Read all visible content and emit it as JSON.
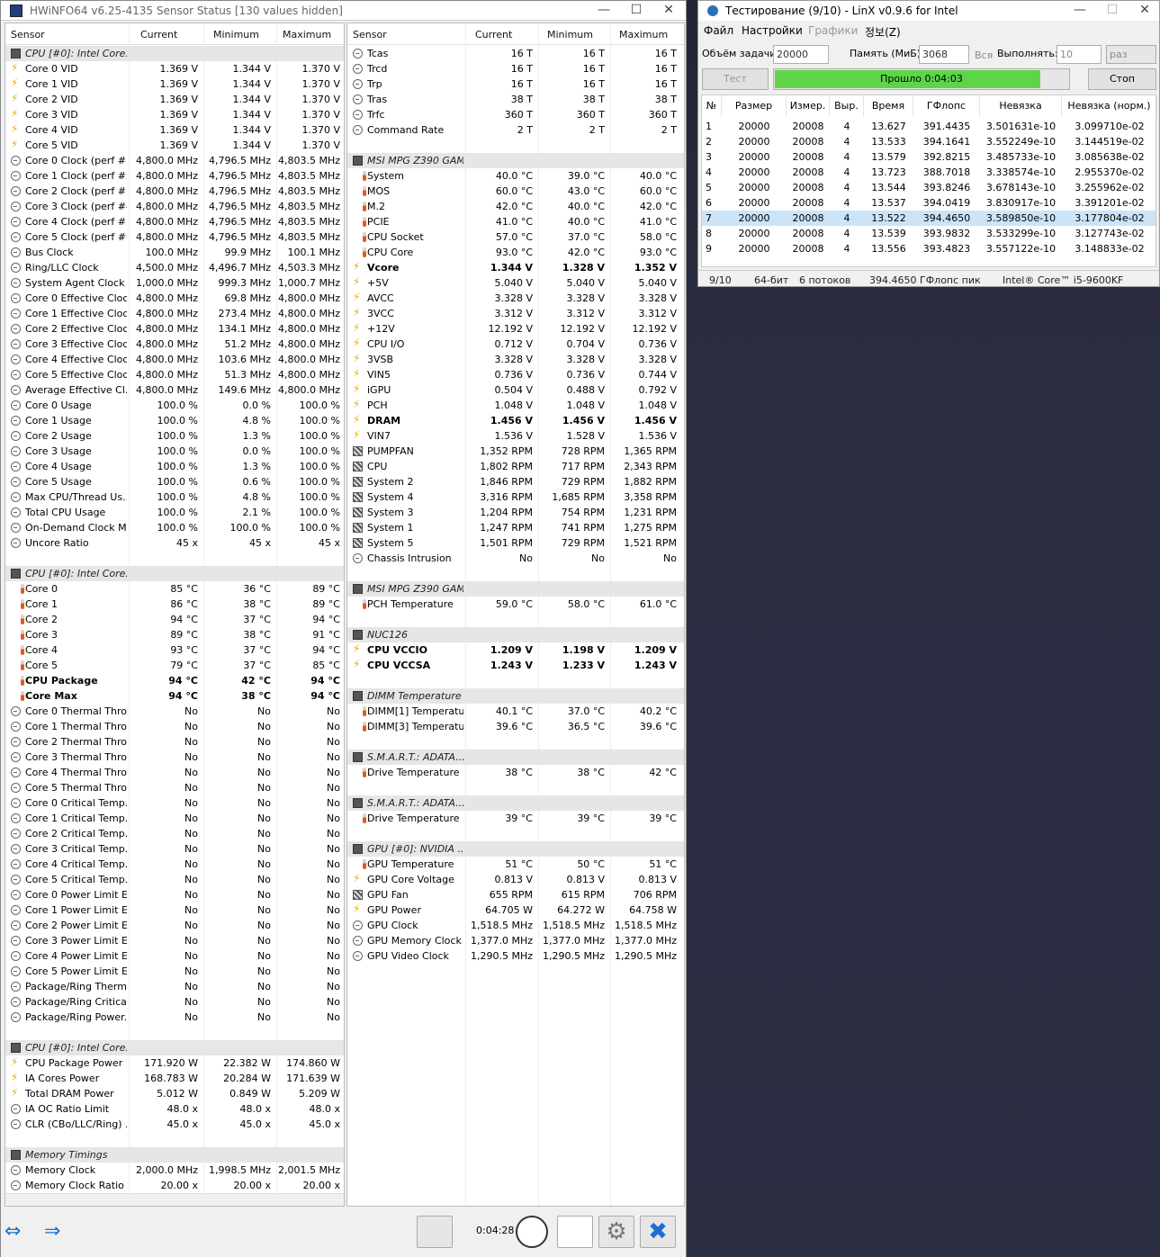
{
  "hwinfo": {
    "title": "HWiNFO64 v6.25-4135 Sensor Status [130 values hidden]",
    "columns": [
      "Sensor",
      "Current",
      "Minimum",
      "Maximum"
    ],
    "left_rows": [
      {
        "k": "sec",
        "n": "CPU [#0]: Intel Core..."
      },
      {
        "i": "bolt",
        "n": "Core 0 VID",
        "c": "1.369 V",
        "mi": "1.344 V",
        "ma": "1.370 V"
      },
      {
        "i": "bolt",
        "n": "Core 1 VID",
        "c": "1.369 V",
        "mi": "1.344 V",
        "ma": "1.370 V"
      },
      {
        "i": "bolt",
        "n": "Core 2 VID",
        "c": "1.369 V",
        "mi": "1.344 V",
        "ma": "1.370 V"
      },
      {
        "i": "bolt",
        "n": "Core 3 VID",
        "c": "1.369 V",
        "mi": "1.344 V",
        "ma": "1.370 V"
      },
      {
        "i": "bolt",
        "n": "Core 4 VID",
        "c": "1.369 V",
        "mi": "1.344 V",
        "ma": "1.370 V"
      },
      {
        "i": "bolt",
        "n": "Core 5 VID",
        "c": "1.369 V",
        "mi": "1.344 V",
        "ma": "1.370 V"
      },
      {
        "i": "circ",
        "n": "Core 0 Clock (perf #1)",
        "c": "4,800.0 MHz",
        "mi": "4,796.5 MHz",
        "ma": "4,803.5 MHz"
      },
      {
        "i": "circ",
        "n": "Core 1 Clock (perf #2)",
        "c": "4,800.0 MHz",
        "mi": "4,796.5 MHz",
        "ma": "4,803.5 MHz"
      },
      {
        "i": "circ",
        "n": "Core 2 Clock (perf #3)",
        "c": "4,800.0 MHz",
        "mi": "4,796.5 MHz",
        "ma": "4,803.5 MHz"
      },
      {
        "i": "circ",
        "n": "Core 3 Clock (perf #4)",
        "c": "4,800.0 MHz",
        "mi": "4,796.5 MHz",
        "ma": "4,803.5 MHz"
      },
      {
        "i": "circ",
        "n": "Core 4 Clock (perf #5)",
        "c": "4,800.0 MHz",
        "mi": "4,796.5 MHz",
        "ma": "4,803.5 MHz"
      },
      {
        "i": "circ",
        "n": "Core 5 Clock (perf #6)",
        "c": "4,800.0 MHz",
        "mi": "4,796.5 MHz",
        "ma": "4,803.5 MHz"
      },
      {
        "i": "circ",
        "n": "Bus Clock",
        "c": "100.0 MHz",
        "mi": "99.9 MHz",
        "ma": "100.1 MHz"
      },
      {
        "i": "circ",
        "n": "Ring/LLC Clock",
        "c": "4,500.0 MHz",
        "mi": "4,496.7 MHz",
        "ma": "4,503.3 MHz"
      },
      {
        "i": "circ",
        "n": "System Agent Clock",
        "c": "1,000.0 MHz",
        "mi": "999.3 MHz",
        "ma": "1,000.7 MHz"
      },
      {
        "i": "circ",
        "n": "Core 0 Effective Clock",
        "c": "4,800.0 MHz",
        "mi": "69.8 MHz",
        "ma": "4,800.0 MHz"
      },
      {
        "i": "circ",
        "n": "Core 1 Effective Clock",
        "c": "4,800.0 MHz",
        "mi": "273.4 MHz",
        "ma": "4,800.0 MHz"
      },
      {
        "i": "circ",
        "n": "Core 2 Effective Clock",
        "c": "4,800.0 MHz",
        "mi": "134.1 MHz",
        "ma": "4,800.0 MHz"
      },
      {
        "i": "circ",
        "n": "Core 3 Effective Clock",
        "c": "4,800.0 MHz",
        "mi": "51.2 MHz",
        "ma": "4,800.0 MHz"
      },
      {
        "i": "circ",
        "n": "Core 4 Effective Clock",
        "c": "4,800.0 MHz",
        "mi": "103.6 MHz",
        "ma": "4,800.0 MHz"
      },
      {
        "i": "circ",
        "n": "Core 5 Effective Clock",
        "c": "4,800.0 MHz",
        "mi": "51.3 MHz",
        "ma": "4,800.0 MHz"
      },
      {
        "i": "circ",
        "n": "Average Effective Cl...",
        "c": "4,800.0 MHz",
        "mi": "149.6 MHz",
        "ma": "4,800.0 MHz"
      },
      {
        "i": "circ",
        "n": "Core 0 Usage",
        "c": "100.0 %",
        "mi": "0.0 %",
        "ma": "100.0 %"
      },
      {
        "i": "circ",
        "n": "Core 1 Usage",
        "c": "100.0 %",
        "mi": "4.8 %",
        "ma": "100.0 %"
      },
      {
        "i": "circ",
        "n": "Core 2 Usage",
        "c": "100.0 %",
        "mi": "1.3 %",
        "ma": "100.0 %"
      },
      {
        "i": "circ",
        "n": "Core 3 Usage",
        "c": "100.0 %",
        "mi": "0.0 %",
        "ma": "100.0 %"
      },
      {
        "i": "circ",
        "n": "Core 4 Usage",
        "c": "100.0 %",
        "mi": "1.3 %",
        "ma": "100.0 %"
      },
      {
        "i": "circ",
        "n": "Core 5 Usage",
        "c": "100.0 %",
        "mi": "0.6 %",
        "ma": "100.0 %"
      },
      {
        "i": "circ",
        "n": "Max CPU/Thread Us...",
        "c": "100.0 %",
        "mi": "4.8 %",
        "ma": "100.0 %"
      },
      {
        "i": "circ",
        "n": "Total CPU Usage",
        "c": "100.0 %",
        "mi": "2.1 %",
        "ma": "100.0 %"
      },
      {
        "i": "circ",
        "n": "On-Demand Clock M...",
        "c": "100.0 %",
        "mi": "100.0 %",
        "ma": "100.0 %"
      },
      {
        "i": "circ",
        "n": "Uncore Ratio",
        "c": "45 x",
        "mi": "45 x",
        "ma": "45 x"
      },
      {
        "k": "blank"
      },
      {
        "k": "sec",
        "n": "CPU [#0]: Intel Core..."
      },
      {
        "i": "therm",
        "n": "Core 0",
        "c": "85 °C",
        "mi": "36 °C",
        "ma": "89 °C"
      },
      {
        "i": "therm",
        "n": "Core 1",
        "c": "86 °C",
        "mi": "38 °C",
        "ma": "89 °C"
      },
      {
        "i": "therm",
        "n": "Core 2",
        "c": "94 °C",
        "mi": "37 °C",
        "ma": "94 °C"
      },
      {
        "i": "therm",
        "n": "Core 3",
        "c": "89 °C",
        "mi": "38 °C",
        "ma": "91 °C"
      },
      {
        "i": "therm",
        "n": "Core 4",
        "c": "93 °C",
        "mi": "37 °C",
        "ma": "94 °C"
      },
      {
        "i": "therm",
        "n": "Core 5",
        "c": "79 °C",
        "mi": "37 °C",
        "ma": "85 °C"
      },
      {
        "i": "therm",
        "n": "CPU Package",
        "c": "94 °C",
        "mi": "42 °C",
        "ma": "94 °C",
        "b": true
      },
      {
        "i": "therm",
        "n": "Core Max",
        "c": "94 °C",
        "mi": "38 °C",
        "ma": "94 °C",
        "b": true
      },
      {
        "i": "circ",
        "n": "Core 0 Thermal Thro...",
        "c": "No",
        "mi": "No",
        "ma": "No"
      },
      {
        "i": "circ",
        "n": "Core 1 Thermal Thro...",
        "c": "No",
        "mi": "No",
        "ma": "No"
      },
      {
        "i": "circ",
        "n": "Core 2 Thermal Thro...",
        "c": "No",
        "mi": "No",
        "ma": "No"
      },
      {
        "i": "circ",
        "n": "Core 3 Thermal Thro...",
        "c": "No",
        "mi": "No",
        "ma": "No"
      },
      {
        "i": "circ",
        "n": "Core 4 Thermal Thro...",
        "c": "No",
        "mi": "No",
        "ma": "No"
      },
      {
        "i": "circ",
        "n": "Core 5 Thermal Thro...",
        "c": "No",
        "mi": "No",
        "ma": "No"
      },
      {
        "i": "circ",
        "n": "Core 0 Critical Temp...",
        "c": "No",
        "mi": "No",
        "ma": "No"
      },
      {
        "i": "circ",
        "n": "Core 1 Critical Temp...",
        "c": "No",
        "mi": "No",
        "ma": "No"
      },
      {
        "i": "circ",
        "n": "Core 2 Critical Temp...",
        "c": "No",
        "mi": "No",
        "ma": "No"
      },
      {
        "i": "circ",
        "n": "Core 3 Critical Temp...",
        "c": "No",
        "mi": "No",
        "ma": "No"
      },
      {
        "i": "circ",
        "n": "Core 4 Critical Temp...",
        "c": "No",
        "mi": "No",
        "ma": "No"
      },
      {
        "i": "circ",
        "n": "Core 5 Critical Temp...",
        "c": "No",
        "mi": "No",
        "ma": "No"
      },
      {
        "i": "circ",
        "n": "Core 0 Power Limit E...",
        "c": "No",
        "mi": "No",
        "ma": "No"
      },
      {
        "i": "circ",
        "n": "Core 1 Power Limit E...",
        "c": "No",
        "mi": "No",
        "ma": "No"
      },
      {
        "i": "circ",
        "n": "Core 2 Power Limit E...",
        "c": "No",
        "mi": "No",
        "ma": "No"
      },
      {
        "i": "circ",
        "n": "Core 3 Power Limit E...",
        "c": "No",
        "mi": "No",
        "ma": "No"
      },
      {
        "i": "circ",
        "n": "Core 4 Power Limit E...",
        "c": "No",
        "mi": "No",
        "ma": "No"
      },
      {
        "i": "circ",
        "n": "Core 5 Power Limit E...",
        "c": "No",
        "mi": "No",
        "ma": "No"
      },
      {
        "i": "circ",
        "n": "Package/Ring Therm...",
        "c": "No",
        "mi": "No",
        "ma": "No"
      },
      {
        "i": "circ",
        "n": "Package/Ring Critical...",
        "c": "No",
        "mi": "No",
        "ma": "No"
      },
      {
        "i": "circ",
        "n": "Package/Ring Power...",
        "c": "No",
        "mi": "No",
        "ma": "No"
      },
      {
        "k": "blank"
      },
      {
        "k": "sec",
        "n": "CPU [#0]: Intel Core..."
      },
      {
        "i": "bolt",
        "n": "CPU Package Power",
        "c": "171.920 W",
        "mi": "22.382 W",
        "ma": "174.860 W"
      },
      {
        "i": "bolt",
        "n": "IA Cores Power",
        "c": "168.783 W",
        "mi": "20.284 W",
        "ma": "171.639 W"
      },
      {
        "i": "bolt",
        "n": "Total DRAM Power",
        "c": "5.012 W",
        "mi": "0.849 W",
        "ma": "5.209 W"
      },
      {
        "i": "circ",
        "n": "IA OC Ratio Limit",
        "c": "48.0 x",
        "mi": "48.0 x",
        "ma": "48.0 x"
      },
      {
        "i": "circ",
        "n": "CLR (CBo/LLC/Ring) ...",
        "c": "45.0 x",
        "mi": "45.0 x",
        "ma": "45.0 x"
      },
      {
        "k": "blank"
      },
      {
        "k": "sec",
        "n": "Memory Timings"
      },
      {
        "i": "circ",
        "n": "Memory Clock",
        "c": "2,000.0 MHz",
        "mi": "1,998.5 MHz",
        "ma": "2,001.5 MHz"
      },
      {
        "i": "circ",
        "n": "Memory Clock Ratio",
        "c": "20.00 x",
        "mi": "20.00 x",
        "ma": "20.00 x"
      }
    ],
    "right_rows": [
      {
        "i": "circ",
        "n": "Tcas",
        "c": "16 T",
        "mi": "16 T",
        "ma": "16 T"
      },
      {
        "i": "circ",
        "n": "Trcd",
        "c": "16 T",
        "mi": "16 T",
        "ma": "16 T"
      },
      {
        "i": "circ",
        "n": "Trp",
        "c": "16 T",
        "mi": "16 T",
        "ma": "16 T"
      },
      {
        "i": "circ",
        "n": "Tras",
        "c": "38 T",
        "mi": "38 T",
        "ma": "38 T"
      },
      {
        "i": "circ",
        "n": "Trfc",
        "c": "360 T",
        "mi": "360 T",
        "ma": "360 T"
      },
      {
        "i": "circ",
        "n": "Command Rate",
        "c": "2 T",
        "mi": "2 T",
        "ma": "2 T"
      },
      {
        "k": "blank"
      },
      {
        "k": "sec",
        "n": "MSI MPG Z390 GAM..."
      },
      {
        "i": "therm",
        "n": "System",
        "c": "40.0 °C",
        "mi": "39.0 °C",
        "ma": "40.0 °C"
      },
      {
        "i": "therm",
        "n": "MOS",
        "c": "60.0 °C",
        "mi": "43.0 °C",
        "ma": "60.0 °C"
      },
      {
        "i": "therm",
        "n": "M.2",
        "c": "42.0 °C",
        "mi": "40.0 °C",
        "ma": "42.0 °C"
      },
      {
        "i": "therm",
        "n": "PCIE",
        "c": "41.0 °C",
        "mi": "40.0 °C",
        "ma": "41.0 °C"
      },
      {
        "i": "therm",
        "n": "CPU Socket",
        "c": "57.0 °C",
        "mi": "37.0 °C",
        "ma": "58.0 °C"
      },
      {
        "i": "therm",
        "n": "CPU Core",
        "c": "93.0 °C",
        "mi": "42.0 °C",
        "ma": "93.0 °C"
      },
      {
        "i": "bolt",
        "n": "Vcore",
        "c": "1.344 V",
        "mi": "1.328 V",
        "ma": "1.352 V",
        "b": true
      },
      {
        "i": "bolt",
        "n": "+5V",
        "c": "5.040 V",
        "mi": "5.040 V",
        "ma": "5.040 V"
      },
      {
        "i": "bolt",
        "n": "AVCC",
        "c": "3.328 V",
        "mi": "3.328 V",
        "ma": "3.328 V"
      },
      {
        "i": "bolt",
        "n": "3VCC",
        "c": "3.312 V",
        "mi": "3.312 V",
        "ma": "3.312 V"
      },
      {
        "i": "bolt",
        "n": "+12V",
        "c": "12.192 V",
        "mi": "12.192 V",
        "ma": "12.192 V"
      },
      {
        "i": "bolt",
        "n": "CPU I/O",
        "c": "0.712 V",
        "mi": "0.704 V",
        "ma": "0.736 V"
      },
      {
        "i": "bolt",
        "n": "3VSB",
        "c": "3.328 V",
        "mi": "3.328 V",
        "ma": "3.328 V"
      },
      {
        "i": "bolt",
        "n": "VIN5",
        "c": "0.736 V",
        "mi": "0.736 V",
        "ma": "0.744 V"
      },
      {
        "i": "bolt",
        "n": "iGPU",
        "c": "0.504 V",
        "mi": "0.488 V",
        "ma": "0.792 V"
      },
      {
        "i": "bolt",
        "n": "PCH",
        "c": "1.048 V",
        "mi": "1.048 V",
        "ma": "1.048 V"
      },
      {
        "i": "bolt",
        "n": "DRAM",
        "c": "1.456 V",
        "mi": "1.456 V",
        "ma": "1.456 V",
        "b": true
      },
      {
        "i": "bolt",
        "n": "VIN7",
        "c": "1.536 V",
        "mi": "1.528 V",
        "ma": "1.536 V"
      },
      {
        "i": "fan",
        "n": "PUMPFAN",
        "c": "1,352 RPM",
        "mi": "728 RPM",
        "ma": "1,365 RPM"
      },
      {
        "i": "fan",
        "n": "CPU",
        "c": "1,802 RPM",
        "mi": "717 RPM",
        "ma": "2,343 RPM"
      },
      {
        "i": "fan",
        "n": "System 2",
        "c": "1,846 RPM",
        "mi": "729 RPM",
        "ma": "1,882 RPM"
      },
      {
        "i": "fan",
        "n": "System 4",
        "c": "3,316 RPM",
        "mi": "1,685 RPM",
        "ma": "3,358 RPM"
      },
      {
        "i": "fan",
        "n": "System 3",
        "c": "1,204 RPM",
        "mi": "754 RPM",
        "ma": "1,231 RPM"
      },
      {
        "i": "fan",
        "n": "System 1",
        "c": "1,247 RPM",
        "mi": "741 RPM",
        "ma": "1,275 RPM"
      },
      {
        "i": "fan",
        "n": "System 5",
        "c": "1,501 RPM",
        "mi": "729 RPM",
        "ma": "1,521 RPM"
      },
      {
        "i": "circ",
        "n": "Chassis Intrusion",
        "c": "No",
        "mi": "No",
        "ma": "No"
      },
      {
        "k": "blank"
      },
      {
        "k": "sec",
        "n": "MSI MPG Z390 GAM..."
      },
      {
        "i": "therm",
        "n": "PCH Temperature",
        "c": "59.0 °C",
        "mi": "58.0 °C",
        "ma": "61.0 °C"
      },
      {
        "k": "blank"
      },
      {
        "k": "sec",
        "n": "NUC126"
      },
      {
        "i": "bolt",
        "n": "CPU VCCIO",
        "c": "1.209 V",
        "mi": "1.198 V",
        "ma": "1.209 V",
        "b": true
      },
      {
        "i": "bolt",
        "n": "CPU VCCSA",
        "c": "1.243 V",
        "mi": "1.233 V",
        "ma": "1.243 V",
        "b": true
      },
      {
        "k": "blank"
      },
      {
        "k": "sec",
        "n": "DIMM Temperature ..."
      },
      {
        "i": "therm",
        "n": "DIMM[1] Temperature",
        "c": "40.1 °C",
        "mi": "37.0 °C",
        "ma": "40.2 °C"
      },
      {
        "i": "therm",
        "n": "DIMM[3] Temperature",
        "c": "39.6 °C",
        "mi": "36.5 °C",
        "ma": "39.6 °C"
      },
      {
        "k": "blank"
      },
      {
        "k": "sec",
        "n": "S.M.A.R.T.: ADATA..."
      },
      {
        "i": "therm",
        "n": "Drive Temperature",
        "c": "38 °C",
        "mi": "38 °C",
        "ma": "42 °C"
      },
      {
        "k": "blank"
      },
      {
        "k": "sec",
        "n": "S.M.A.R.T.: ADATA..."
      },
      {
        "i": "therm",
        "n": "Drive Temperature",
        "c": "39 °C",
        "mi": "39 °C",
        "ma": "39 °C"
      },
      {
        "k": "blank"
      },
      {
        "k": "sec",
        "n": "GPU [#0]: NVIDIA ..."
      },
      {
        "i": "therm",
        "n": "GPU Temperature",
        "c": "51 °C",
        "mi": "50 °C",
        "ma": "51 °C"
      },
      {
        "i": "bolt",
        "n": "GPU Core Voltage",
        "c": "0.813 V",
        "mi": "0.813 V",
        "ma": "0.813 V"
      },
      {
        "i": "fan",
        "n": "GPU Fan",
        "c": "655 RPM",
        "mi": "615 RPM",
        "ma": "706 RPM"
      },
      {
        "i": "bolt",
        "n": "GPU Power",
        "c": "64.705 W",
        "mi": "64.272 W",
        "ma": "64.758 W"
      },
      {
        "i": "circ",
        "n": "GPU Clock",
        "c": "1,518.5 MHz",
        "mi": "1,518.5 MHz",
        "ma": "1,518.5 MHz"
      },
      {
        "i": "circ",
        "n": "GPU Memory Clock",
        "c": "1,377.0 MHz",
        "mi": "1,377.0 MHz",
        "ma": "1,377.0 MHz"
      },
      {
        "i": "circ",
        "n": "GPU Video Clock",
        "c": "1,290.5 MHz",
        "mi": "1,290.5 MHz",
        "ma": "1,290.5 MHz"
      }
    ],
    "elapsed": "0:04:28"
  },
  "linx": {
    "title": "Тестирование (9/10) - LinX v0.9.6 for Intel",
    "menu": [
      "Файл",
      "Настройки",
      "Графики",
      "정보(Z)"
    ],
    "size_label": "Объём задачи:",
    "size_value": "20000",
    "mem_label": "Память (МиБ):",
    "mem_value": "3068",
    "all_label": "Вся",
    "run_label": "Выполнять:",
    "run_value": "10",
    "unit_value": "раз",
    "test_btn": "Тест",
    "progress_text": "Прошло 0:04:03",
    "progress_fraction": 0.9,
    "stop_btn": "Стоп",
    "columns": [
      "№",
      "Размер",
      "Измер.",
      "Выр.",
      "Время",
      "ГФлопс",
      "Невязка",
      "Невязка (норм.)"
    ],
    "rows": [
      [
        "1",
        "20000",
        "20008",
        "4",
        "13.627",
        "391.4435",
        "3.501631e-10",
        "3.099710e-02"
      ],
      [
        "2",
        "20000",
        "20008",
        "4",
        "13.533",
        "394.1641",
        "3.552249e-10",
        "3.144519e-02"
      ],
      [
        "3",
        "20000",
        "20008",
        "4",
        "13.579",
        "392.8215",
        "3.485733e-10",
        "3.085638e-02"
      ],
      [
        "4",
        "20000",
        "20008",
        "4",
        "13.723",
        "388.7018",
        "3.338574e-10",
        "2.955370e-02"
      ],
      [
        "5",
        "20000",
        "20008",
        "4",
        "13.544",
        "393.8246",
        "3.678143e-10",
        "3.255962e-02"
      ],
      [
        "6",
        "20000",
        "20008",
        "4",
        "13.537",
        "394.0419",
        "3.830917e-10",
        "3.391201e-02"
      ],
      [
        "7",
        "20000",
        "20008",
        "4",
        "13.522",
        "394.4650",
        "3.589850e-10",
        "3.177804e-02"
      ],
      [
        "8",
        "20000",
        "20008",
        "4",
        "13.539",
        "393.9832",
        "3.533299e-10",
        "3.127743e-02"
      ],
      [
        "9",
        "20000",
        "20008",
        "4",
        "13.556",
        "393.4823",
        "3.557122e-10",
        "3.148833e-02"
      ]
    ],
    "selected_row": 7,
    "status": [
      "9/10",
      "64-бит",
      "6 потоков",
      "394.4650 ГФлопс пик",
      "Intel® Core™ i5-9600KF"
    ]
  }
}
